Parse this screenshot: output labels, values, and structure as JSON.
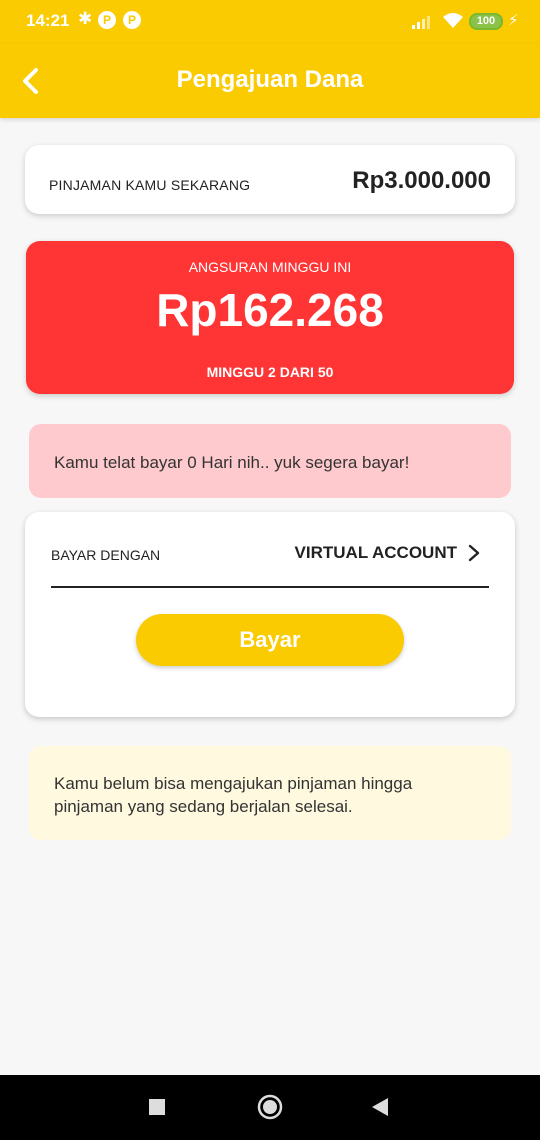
{
  "status_bar": {
    "time": "14:21",
    "bluetooth": "✱",
    "notif_1": "P",
    "notif_2": "P",
    "battery": "100"
  },
  "app_bar": {
    "title": "Pengajuan Dana"
  },
  "loan_card": {
    "label": "PINJAMAN KAMU SEKARANG",
    "amount": "Rp3.000.000"
  },
  "installment_card": {
    "label": "ANGSURAN MINGGU INI",
    "amount": "Rp162.268",
    "week": "MINGGU 2 DARI 50"
  },
  "late_notice": {
    "text": "Kamu telat bayar 0 Hari nih.. yuk segera bayar!"
  },
  "payment": {
    "method_label": "BAYAR DENGAN",
    "method_value": "VIRTUAL ACCOUNT",
    "pay_button": "Bayar"
  },
  "info_notice": {
    "text": "Kamu belum bisa mengajukan pinjaman hingga pinjaman yang sedang berjalan selesai."
  },
  "colors": {
    "primary": "#f9cb00",
    "danger": "#ff3434",
    "late_bg": "#ffcacd",
    "info_bg": "#fff9e0"
  }
}
